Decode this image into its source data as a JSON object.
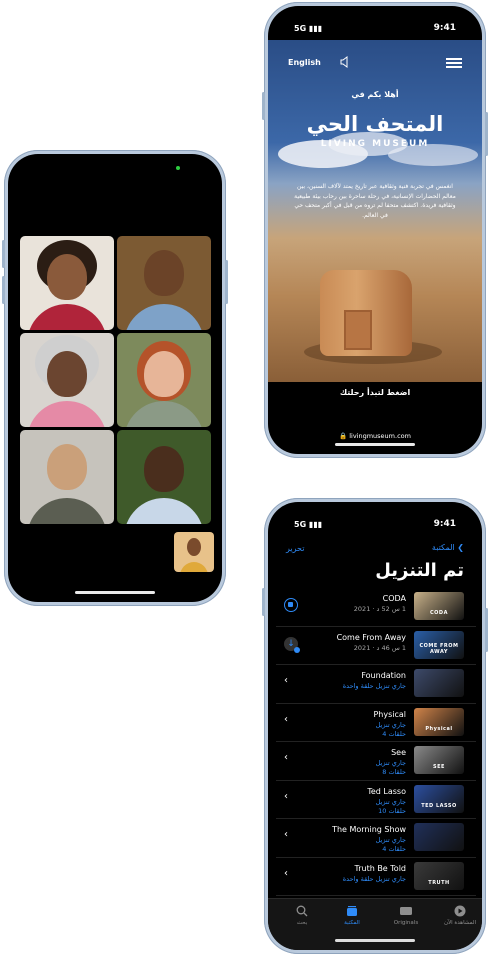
{
  "museum": {
    "status": {
      "signal": "5G",
      "time": "9:41"
    },
    "language": "English",
    "welcome": "أهلا بكم في",
    "title_ar": "المتحف الحي",
    "title_en": "LIVING MUSEUM",
    "description": "انغمس في تجربة فنية وثقافية عبر تاريخ يمتد لآلاف السنين، بين معالم الحضارات الإنسانية، في رحلة ساحرة بين رحاب بيئة طبيعية وثقافية فريدة. اكتشف متحفا لم تروه من قبل في أكبر متحف حي في العالم.",
    "cta": "اضغط لتبدأ رحلتك",
    "url": "livingmuseum.com"
  },
  "tv": {
    "status": {
      "signal": "5G",
      "time": "9:41"
    },
    "nav": {
      "edit": "تحرير",
      "back": "المكتبة"
    },
    "title": "تم التنزيل",
    "rows": [
      {
        "title": "CODA",
        "sub": "1 س 52 د · 2021",
        "sub2": "",
        "thumb": "CODA",
        "control": "progress",
        "color": "#c9b28a"
      },
      {
        "title": "Come From Away",
        "sub": "1 س 46 د · 2021",
        "sub2": "",
        "thumb": "COME FROM AWAY",
        "control": "downloading",
        "color": "#2a5fa8"
      },
      {
        "title": "Foundation",
        "sub": "جاري تنزيل حلقة واحدة",
        "sub2": "",
        "thumb": "",
        "control": "chevron",
        "color": "#3d4a6a"
      },
      {
        "title": "Physical",
        "sub": "جاري تنزيل",
        "sub2": "4 حلقات",
        "thumb": "Physical",
        "control": "chevron",
        "color": "#d1844a"
      },
      {
        "title": "See",
        "sub": "جاري تنزيل",
        "sub2": "8 حلقات",
        "thumb": "SEE",
        "control": "chevron",
        "color": "#8a8a8a"
      },
      {
        "title": "Ted Lasso",
        "sub": "جاري تنزيل",
        "sub2": "10 حلقات",
        "thumb": "TED LASSO",
        "control": "chevron",
        "color": "#2c4fa0"
      },
      {
        "title": "The Morning Show",
        "sub": "جاري تنزيل",
        "sub2": "4 حلقات",
        "thumb": "",
        "control": "chevron",
        "color": "#20305a"
      },
      {
        "title": "Truth Be Told",
        "sub": "جاري تنزيل حلقة واحدة",
        "sub2": "",
        "thumb": "TRUTH",
        "control": "chevron",
        "color": "#3a3a3a"
      }
    ],
    "tabs": [
      {
        "label": "المشاهدة الآن",
        "icon": "play-circle-icon"
      },
      {
        "label": "Originals",
        "icon": "tv-icon"
      },
      {
        "label": "المكتبة",
        "icon": "library-icon",
        "active": true
      },
      {
        "label": "بحث",
        "icon": "search-icon"
      }
    ],
    "accent": "#2f8bf7"
  }
}
